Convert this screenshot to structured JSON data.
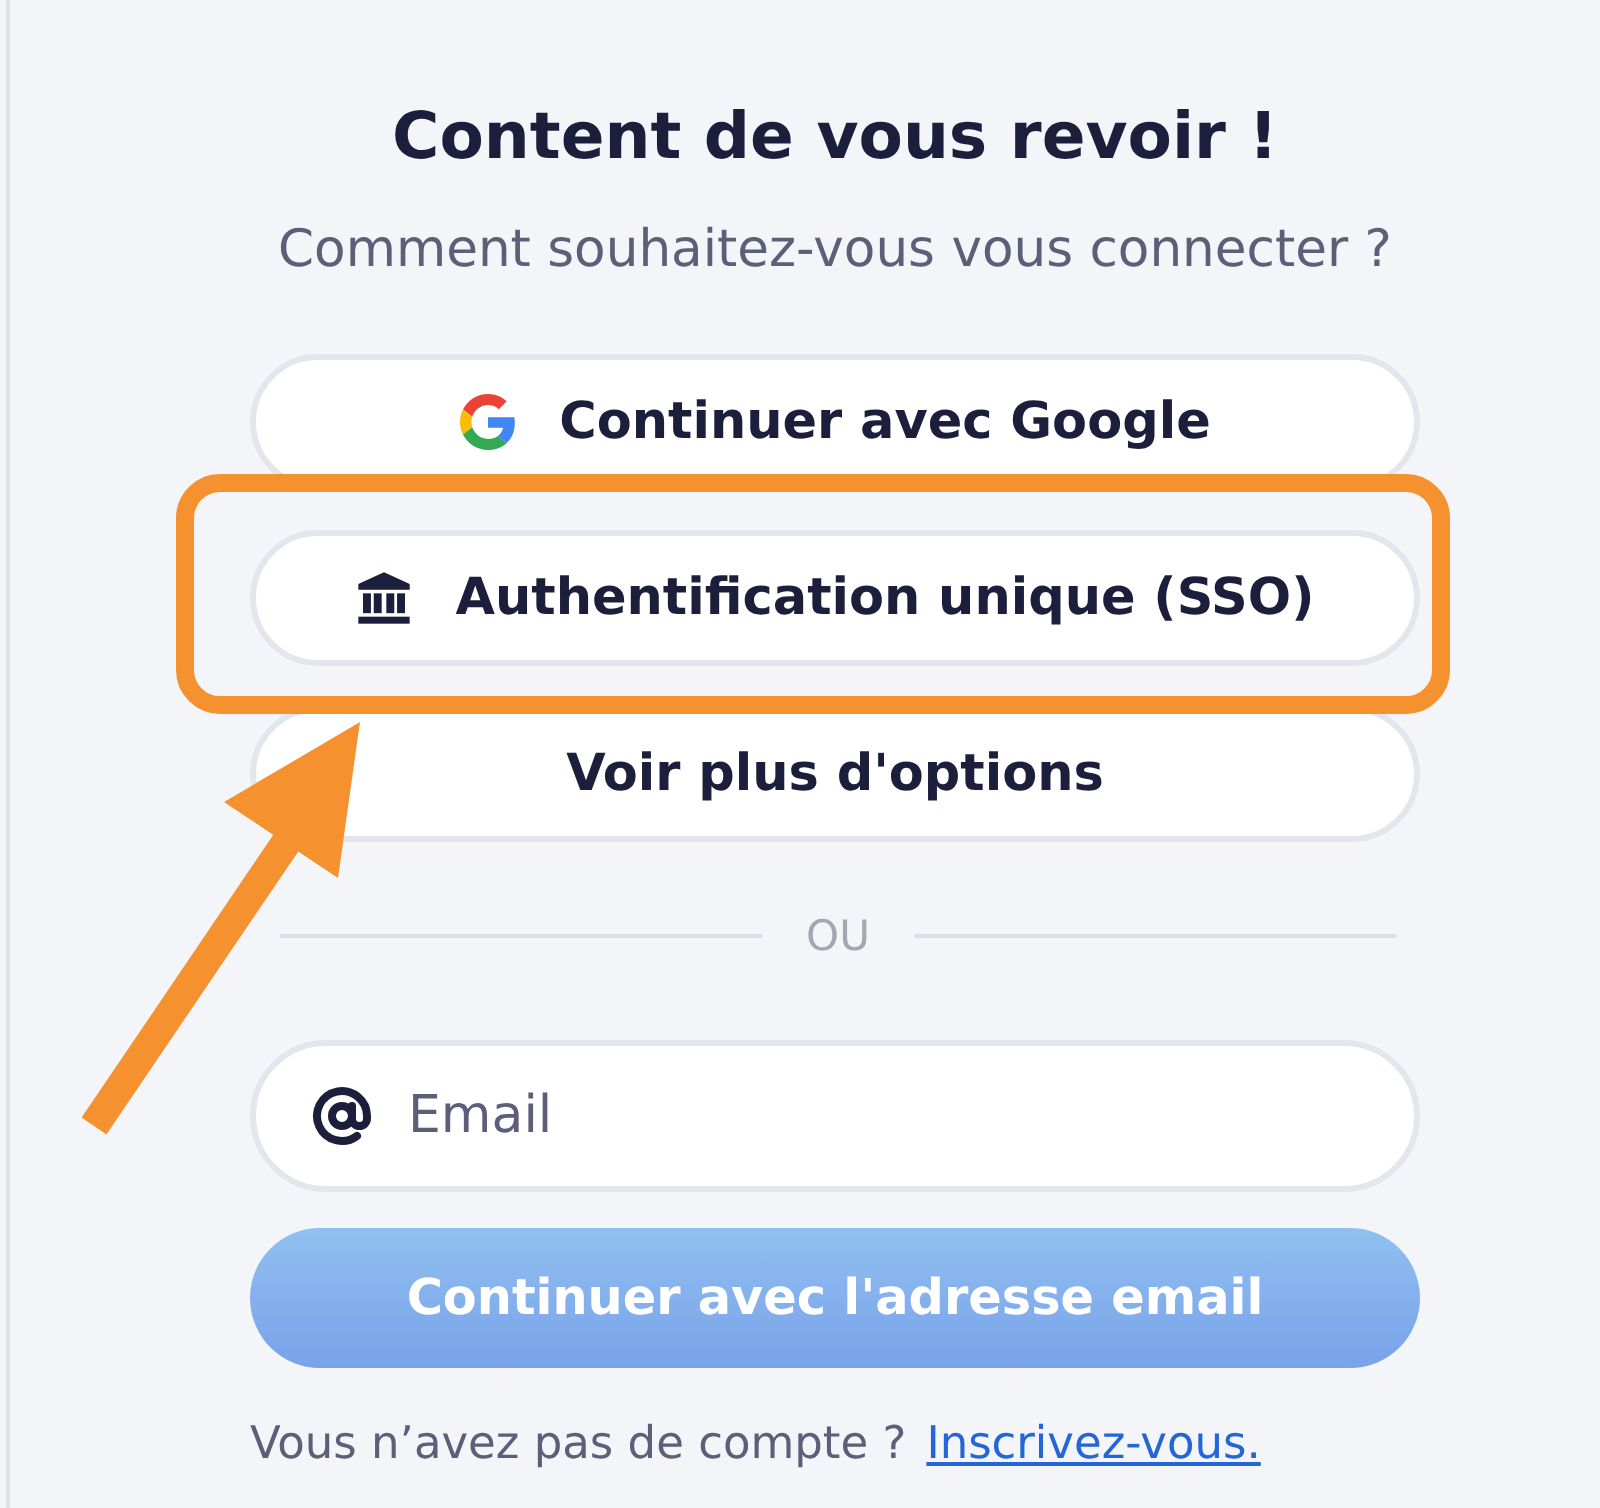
{
  "heading": "Content de vous revoir !",
  "subtitle": "Comment souhaitez-vous vous connecter ?",
  "options": [
    {
      "kind": "google",
      "label": "Continuer avec Google",
      "highlighted": false
    },
    {
      "kind": "sso",
      "label": "Authentification unique (SSO)",
      "highlighted": true
    },
    {
      "kind": "more",
      "label": "Voir plus d'options",
      "highlighted": false
    }
  ],
  "divider": "OU",
  "email_field": {
    "placeholder": "Email"
  },
  "submit_button": {
    "label": "Continuer avec l'adresse email",
    "disabled": true
  },
  "footer": {
    "text": "Vous n’avez pas de compte ?",
    "link": "Inscrivez-vous."
  }
}
